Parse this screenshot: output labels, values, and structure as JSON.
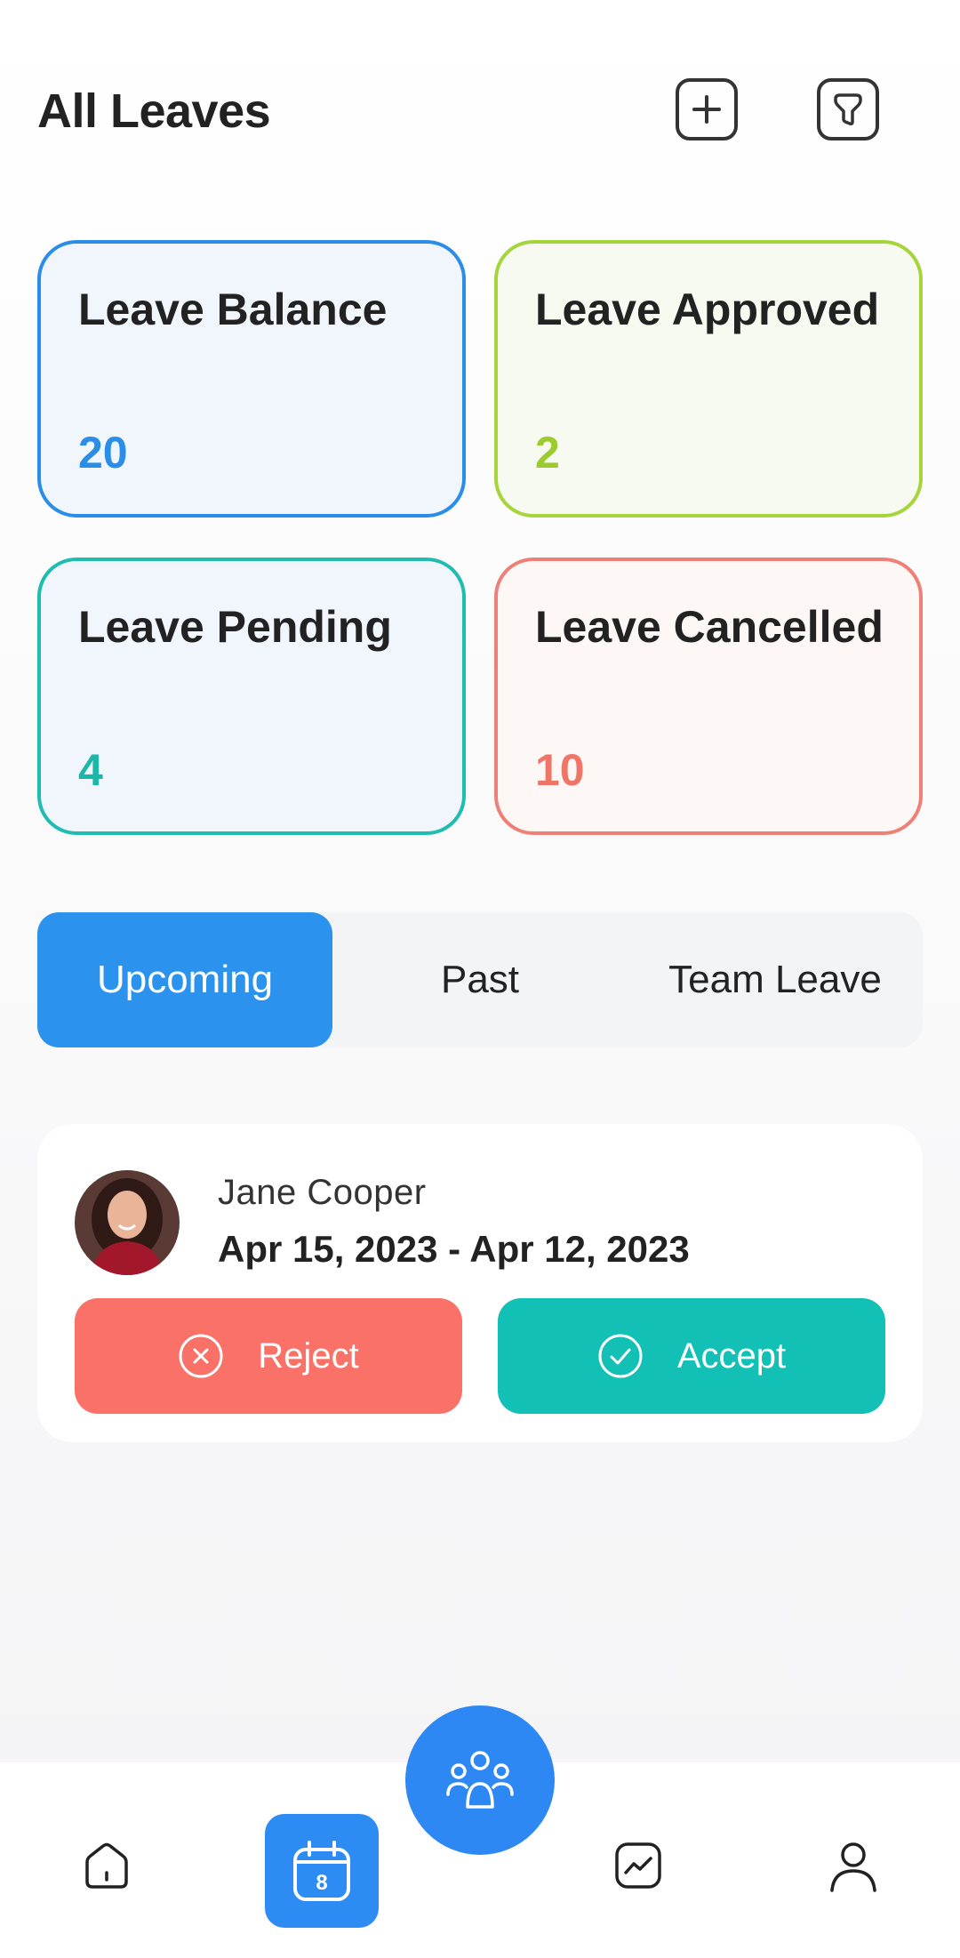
{
  "header": {
    "title": "All Leaves"
  },
  "stats": {
    "balance": {
      "label": "Leave Balance",
      "value": "20"
    },
    "approved": {
      "label": "Leave Approved",
      "value": "2"
    },
    "pending": {
      "label": "Leave Pending",
      "value": "4"
    },
    "cancelled": {
      "label": "Leave Cancelled",
      "value": "10"
    }
  },
  "tabs": [
    {
      "label": "Upcoming",
      "active": true
    },
    {
      "label": "Past",
      "active": false
    },
    {
      "label": "Team Leave",
      "active": false
    }
  ],
  "requests": [
    {
      "name": "Jane Cooper",
      "dates": "Apr 15, 2023 - Apr 12, 2023",
      "reject_label": "Reject",
      "accept_label": "Accept"
    }
  ],
  "nav": {
    "calendar_day": "8",
    "items": [
      "home-icon",
      "calendar-icon",
      "team-icon",
      "chart-icon",
      "profile-icon"
    ]
  },
  "colors": {
    "primary": "#2b93ee",
    "approved": "#a6d43b",
    "pending": "#1fbcb0",
    "cancelled": "#ee8077",
    "reject": "#fa7168",
    "accept": "#12c0b5"
  }
}
